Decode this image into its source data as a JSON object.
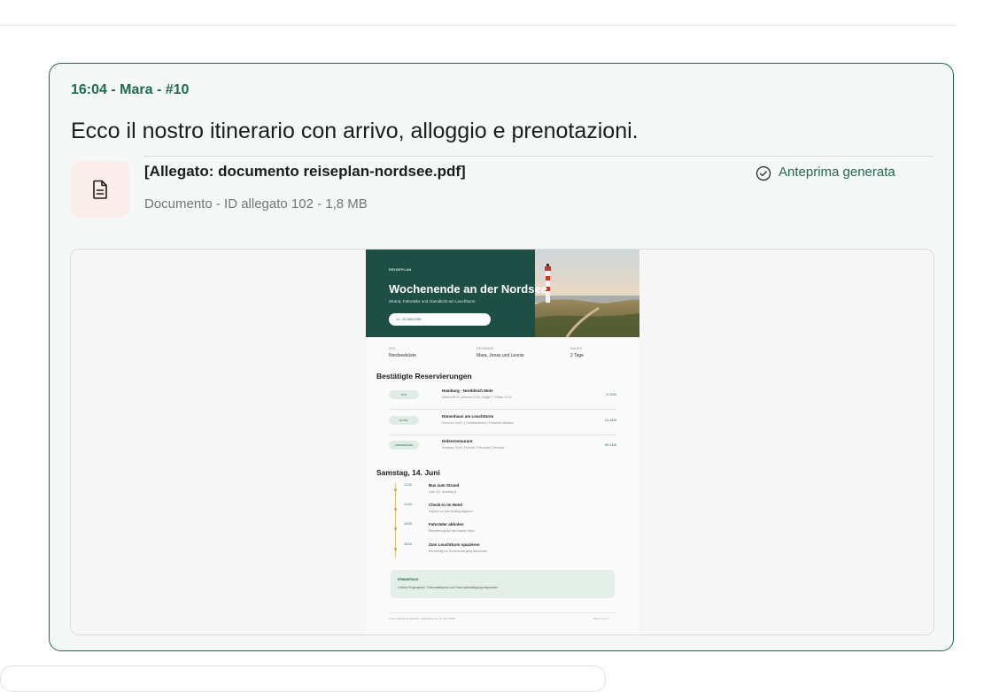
{
  "message": {
    "meta": "16:04 - Mara - #10",
    "text": "Ecco il nostro itinerario con arrivo, alloggio e prenotazioni.",
    "attachment": {
      "title": "[Allegato: documento reiseplan-nordsee.pdf]",
      "subtitle": "Documento - ID allegato 102 - 1,8 MB",
      "status": "Anteprima generata",
      "icon": "file-text-icon"
    }
  },
  "document": {
    "eyebrow": "REISEPLAN",
    "title": "Wochenende an der Nordsee",
    "tagline": "Strand, Fahrräder und Abendlicht am Leuchtturm",
    "date_pill": "14 - 15 JUNI 2026",
    "facts": [
      {
        "key": "ZIEL",
        "value": "Nordseeküste"
      },
      {
        "key": "REISENDE",
        "value": "Mara, Jonas und Leonie"
      },
      {
        "key": "DAUER",
        "value": "2 Tage"
      }
    ],
    "reservations_title": "Bestätigte Reservierungen",
    "reservations": [
      {
        "tag": "ZUG",
        "title": "Hamburg - Norddeich Mole",
        "detail": "Abfahrt 08:12 | Ankunft 11:04 | Wagen 7, Plätze 12-14",
        "code": "IC 2024"
      },
      {
        "tag": "HOTEL",
        "title": "Dünenhaus am Leuchtturm",
        "detail": "Check-in 14:00 | 1 Dreibettzimmer | Frühstück inklusive",
        "code": "DL-4819"
      },
      {
        "tag": "ABENDESSEN",
        "title": "Hafenrestaurant",
        "detail": "Samstag 19:00 | Tisch für 3 Personen | Terrasse",
        "code": "HR-1406"
      }
    ],
    "day_title": "Samstag, 14. Juni",
    "timeline": [
      {
        "time": "12:20",
        "title": "Bus zum Strand",
        "detail": "Linie 412, Bussteig B"
      },
      {
        "time": "14:00",
        "title": "Check-in im Hotel",
        "detail": "Gepäck vor dem Ausflug abgeben"
      },
      {
        "time": "15:30",
        "title": "Fahrräder abholen",
        "detail": "Reservierung auf den Namen Mara"
      },
      {
        "time": "18:15",
        "title": "Zum Leuchtturm spazieren",
        "detail": "Rechtzeitig vor Sonnenuntergang ankommen"
      }
    ],
    "note_key": "ERINNERUNG",
    "note_text": "Leichte Regenjacke, Thermosflasche und Fahrradbestätigung einpacken.",
    "footer_left": "In der Unterkunft gebucht · aktualisiert am 12. April 2026",
    "footer_right": "Seite 1 von 1"
  },
  "colors": {
    "accent": "#1f6b4a",
    "card_bg": "#f4f8f6",
    "hero": "#1e4f44",
    "file_tile": "#fbeeea"
  }
}
